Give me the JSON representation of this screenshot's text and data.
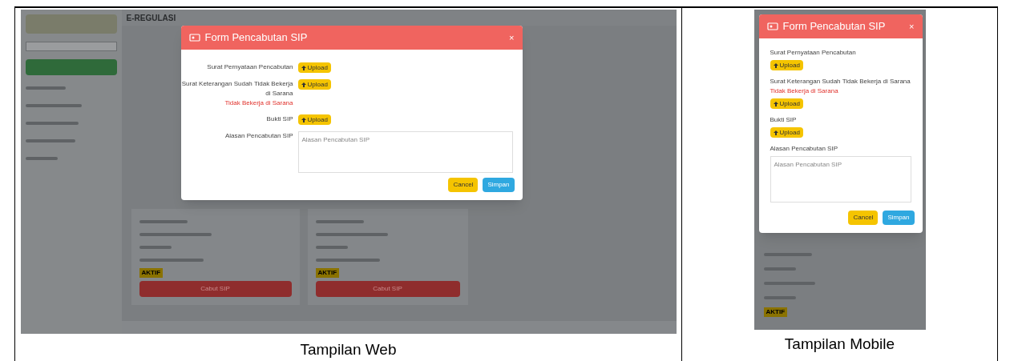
{
  "web": {
    "app_title": "E-REGULASI",
    "sidebar_active_item": true,
    "modal": {
      "title": "Form Pencabutan SIP",
      "close": "×",
      "fields": [
        {
          "kind": "upload",
          "label": "Surat Pernyataan Pencabutan",
          "button": "Upload"
        },
        {
          "kind": "upload",
          "label": "Surat Keterangan Sudah Tidak Bekerja di Sarana",
          "note": "Tidak Bekerja di Sarana",
          "button": "Upload"
        },
        {
          "kind": "upload",
          "label": "Bukti SIP",
          "button": "Upload"
        },
        {
          "kind": "textarea",
          "label": "Alasan Pencabutan SIP",
          "placeholder": "Alasan Pencabutan SIP"
        }
      ],
      "cancel": "Cancel",
      "save": "Simpan"
    },
    "cards": [
      {
        "status": "AKTIF",
        "action": "Cabut SIP"
      },
      {
        "status": "AKTIF",
        "action": "Cabut SIP"
      }
    ]
  },
  "mobile": {
    "modal": {
      "title": "Form Pencabutan SIP",
      "close": "×",
      "fields": [
        {
          "kind": "upload",
          "label": "Surat Pernyataan Pencabutan",
          "button": "Upload"
        },
        {
          "kind": "upload",
          "label": "Surat Keterangan Sudah Tidak Bekerja di Sarana",
          "note": "Tidak Bekerja di Sarana",
          "button": "Upload"
        },
        {
          "kind": "upload",
          "label": "Bukti SIP",
          "button": "Upload"
        },
        {
          "kind": "textarea",
          "label": "Alasan Pencabutan SIP",
          "placeholder": "Alasan Pencabutan SIP"
        }
      ],
      "cancel": "Cancel",
      "save": "Simpan"
    },
    "status": "AKTIF"
  },
  "captions": [
    "Tampilan Web",
    "Tampilan Mobile"
  ]
}
